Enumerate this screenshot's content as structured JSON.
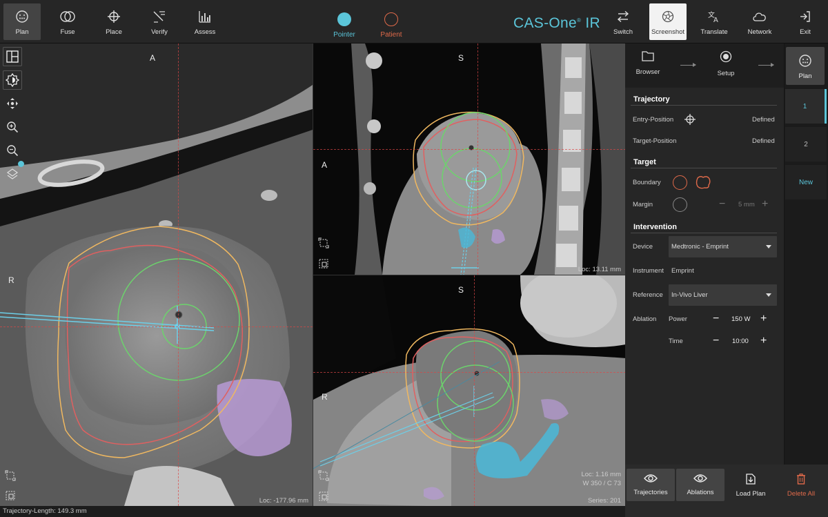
{
  "toolbar": {
    "left_tabs": [
      {
        "label": "Plan",
        "icon": "plan-icon"
      },
      {
        "label": "Fuse",
        "icon": "fuse-icon"
      },
      {
        "label": "Place",
        "icon": "crosshair-icon"
      },
      {
        "label": "Verify",
        "icon": "verify-icon"
      },
      {
        "label": "Assess",
        "icon": "bar-chart-icon"
      }
    ],
    "modes": [
      {
        "label": "Pointer",
        "color": "#5bc5d9"
      },
      {
        "label": "Patient",
        "color": "#e06a4a"
      }
    ],
    "brand": "CAS-One",
    "brand_suffix": "IR",
    "right_buttons": [
      {
        "label": "Switch",
        "icon": "swap-arrows-icon"
      },
      {
        "label": "Screenshot",
        "icon": "aperture-icon"
      },
      {
        "label": "Translate",
        "icon": "translate-icon"
      },
      {
        "label": "Network",
        "icon": "cloud-icon"
      },
      {
        "label": "Exit",
        "icon": "exit-icon"
      }
    ]
  },
  "views": {
    "axial": {
      "top": "A",
      "left": "R",
      "info": "Loc: -177.96 mm"
    },
    "sagittal": {
      "top": "S",
      "left": "A",
      "info": "Loc: 13.11 mm"
    },
    "coronal": {
      "top": "S",
      "left": "R",
      "info1": "Loc: 1.16 mm",
      "info2": "W 350 / C 73",
      "info3": "Series: 201"
    }
  },
  "workflow": {
    "steps": [
      {
        "label": "Browser",
        "icon": "folder-icon"
      },
      {
        "label": "Setup",
        "icon": "target-dot-icon"
      },
      {
        "label": "Plan",
        "icon": "plan-icon"
      }
    ]
  },
  "panel": {
    "trajectory": {
      "title": "Trajectory",
      "entry_label": "Entry-Position",
      "entry_value": "Defined",
      "target_label": "Target-Position",
      "target_value": "Defined"
    },
    "target": {
      "title": "Target",
      "boundary_label": "Boundary",
      "margin_label": "Margin",
      "margin_value": "5 mm"
    },
    "intervention": {
      "title": "Intervention",
      "device_label": "Device",
      "device_value": "Medtronic - Emprint",
      "instrument_label": "Instrument",
      "instrument_value": "Emprint",
      "reference_label": "Reference",
      "reference_value": "In-Vivo Liver",
      "ablation_label": "Ablation",
      "power_label": "Power",
      "power_value": "150 W",
      "time_label": "Time",
      "time_value": "10:00"
    }
  },
  "plans": [
    "1",
    "2",
    "New"
  ],
  "bottom_buttons": [
    {
      "label": "Trajectories",
      "icon": "eye-icon"
    },
    {
      "label": "Ablations",
      "icon": "eye-icon"
    },
    {
      "label": "Load Plan",
      "icon": "load-file-icon"
    },
    {
      "label": "Delete All",
      "icon": "trash-icon"
    }
  ],
  "status": "Trajectory-Length: 149.3 mm",
  "colors": {
    "accent": "#5bc5d9",
    "patient": "#e06a4a",
    "ablation_zone": "#f0b860",
    "margin_zone": "#e04848",
    "antenna": "#6ccfe8",
    "green_zone": "#6cd46c"
  }
}
